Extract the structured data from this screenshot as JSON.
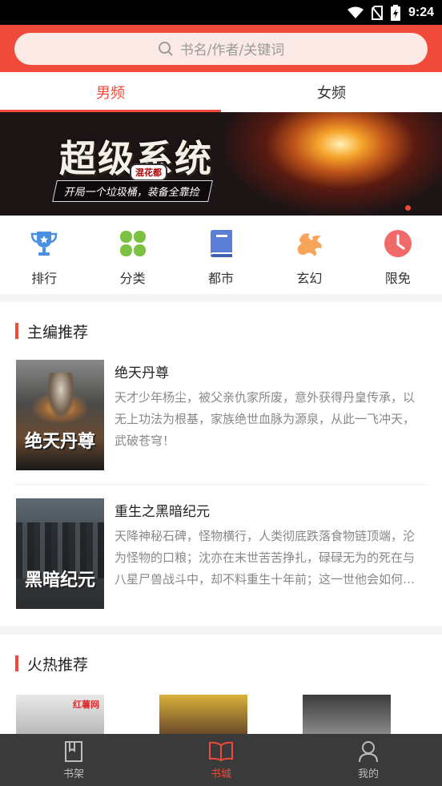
{
  "status": {
    "time": "9:24"
  },
  "search": {
    "placeholder": "书名/作者/关键词"
  },
  "tabs": [
    {
      "label": "男频",
      "active": true
    },
    {
      "label": "女频",
      "active": false
    }
  ],
  "banner": {
    "title": "超级系统",
    "tag": "混花都",
    "subtitle": "开局一个垃圾桶，装备全靠捡",
    "slide_indicator": "1"
  },
  "categories": [
    {
      "label": "排行",
      "icon": "trophy-icon",
      "color": "#4a90e2"
    },
    {
      "label": "分类",
      "icon": "clover-grid-icon",
      "color": "#7cc142"
    },
    {
      "label": "都市",
      "icon": "book-icon",
      "color": "#5b7fd6"
    },
    {
      "label": "玄幻",
      "icon": "dragon-icon",
      "color": "#f5a45a"
    },
    {
      "label": "限免",
      "icon": "clock-icon",
      "color": "#f06a6a"
    }
  ],
  "editor_picks": {
    "title": "主编推荐",
    "books": [
      {
        "name": "绝天丹尊",
        "cover_text": "绝天丹尊",
        "desc": "天才少年杨尘，被父亲仇家所废，意外获得丹皇传承，以无上功法为根基，家族绝世血脉为源泉，从此一飞冲天，武破苍穹！"
      },
      {
        "name": "重生之黑暗纪元",
        "cover_text": "黑暗纪元",
        "desc": "天降神秘石碑，怪物横行，人类彻底跌落食物链顶端，沦为怪物的口粮；沈亦在末世苦苦挣扎，碌碌无为的死在与八星尸兽战斗中，却不料重生十年前；这一世他会如何选择……"
      }
    ]
  },
  "hot_picks": {
    "title": "火热推荐",
    "brand": "红薯网"
  },
  "bottom_nav": [
    {
      "label": "书架",
      "icon": "bookshelf-icon",
      "active": false
    },
    {
      "label": "书城",
      "icon": "open-book-icon",
      "active": true
    },
    {
      "label": "我的",
      "icon": "user-icon",
      "active": false
    }
  ],
  "colors": {
    "accent": "#f04a3a",
    "nav_bg": "#3a3a3a"
  }
}
